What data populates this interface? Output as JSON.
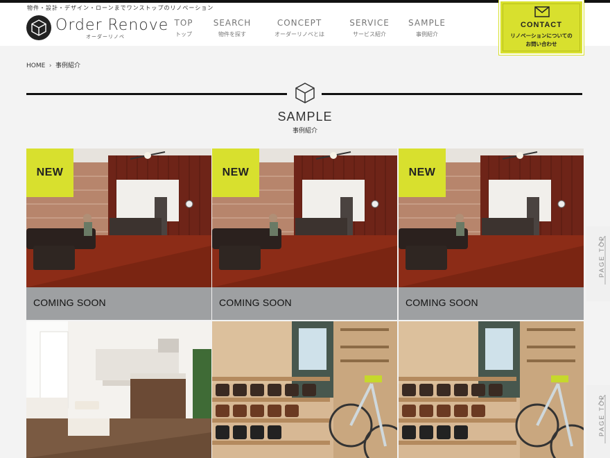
{
  "header": {
    "tagline": "物件・設計・デザイン・ローンまでワンストップのリノベーション",
    "logo_text": "Order Renove",
    "logo_sub": "オーダーリノベ"
  },
  "nav": [
    {
      "en": "TOP",
      "jp": "トップ"
    },
    {
      "en": "SEARCH",
      "jp": "物件を探す"
    },
    {
      "en": "CONCEPT",
      "jp": "オーダーリノベとは"
    },
    {
      "en": "SERVICE",
      "jp": "サービス紹介"
    },
    {
      "en": "SAMPLE",
      "jp": "事例紹介"
    }
  ],
  "contact": {
    "label": "CONTACT",
    "sub_line1": "リノベーションについての",
    "sub_line2": "お問い合わせ"
  },
  "breadcrumb": {
    "home": "HOME",
    "separator": "›",
    "current": "事例紹介"
  },
  "section": {
    "title": "SAMPLE",
    "subtitle": "事例紹介"
  },
  "cards_row1": [
    {
      "badge": "NEW",
      "caption": "COMING SOON"
    },
    {
      "badge": "NEW",
      "caption": "COMING SOON"
    },
    {
      "badge": "NEW",
      "caption": "COMING SOON"
    }
  ],
  "page_top": {
    "label": "PAGE TOP"
  },
  "colors": {
    "accent": "#d8e02e",
    "dark": "#111111",
    "caption_bg": "#9ea0a2"
  }
}
